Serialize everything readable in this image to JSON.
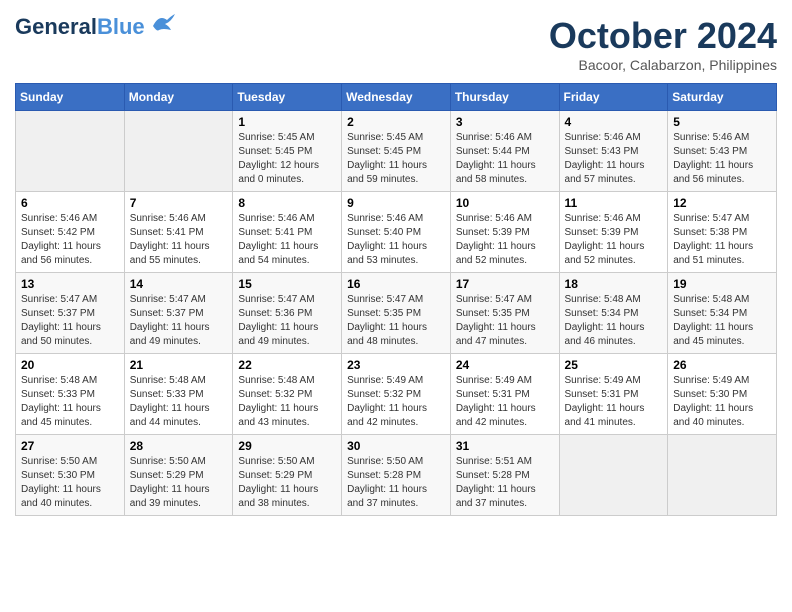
{
  "header": {
    "logo_line1": "General",
    "logo_line2": "Blue",
    "month_year": "October 2024",
    "location": "Bacoor, Calabarzon, Philippines"
  },
  "weekdays": [
    "Sunday",
    "Monday",
    "Tuesday",
    "Wednesday",
    "Thursday",
    "Friday",
    "Saturday"
  ],
  "weeks": [
    [
      {
        "day": "",
        "sunrise": "",
        "sunset": "",
        "daylight": ""
      },
      {
        "day": "",
        "sunrise": "",
        "sunset": "",
        "daylight": ""
      },
      {
        "day": "1",
        "sunrise": "Sunrise: 5:45 AM",
        "sunset": "Sunset: 5:45 PM",
        "daylight": "Daylight: 12 hours and 0 minutes."
      },
      {
        "day": "2",
        "sunrise": "Sunrise: 5:45 AM",
        "sunset": "Sunset: 5:45 PM",
        "daylight": "Daylight: 11 hours and 59 minutes."
      },
      {
        "day": "3",
        "sunrise": "Sunrise: 5:46 AM",
        "sunset": "Sunset: 5:44 PM",
        "daylight": "Daylight: 11 hours and 58 minutes."
      },
      {
        "day": "4",
        "sunrise": "Sunrise: 5:46 AM",
        "sunset": "Sunset: 5:43 PM",
        "daylight": "Daylight: 11 hours and 57 minutes."
      },
      {
        "day": "5",
        "sunrise": "Sunrise: 5:46 AM",
        "sunset": "Sunset: 5:43 PM",
        "daylight": "Daylight: 11 hours and 56 minutes."
      }
    ],
    [
      {
        "day": "6",
        "sunrise": "Sunrise: 5:46 AM",
        "sunset": "Sunset: 5:42 PM",
        "daylight": "Daylight: 11 hours and 56 minutes."
      },
      {
        "day": "7",
        "sunrise": "Sunrise: 5:46 AM",
        "sunset": "Sunset: 5:41 PM",
        "daylight": "Daylight: 11 hours and 55 minutes."
      },
      {
        "day": "8",
        "sunrise": "Sunrise: 5:46 AM",
        "sunset": "Sunset: 5:41 PM",
        "daylight": "Daylight: 11 hours and 54 minutes."
      },
      {
        "day": "9",
        "sunrise": "Sunrise: 5:46 AM",
        "sunset": "Sunset: 5:40 PM",
        "daylight": "Daylight: 11 hours and 53 minutes."
      },
      {
        "day": "10",
        "sunrise": "Sunrise: 5:46 AM",
        "sunset": "Sunset: 5:39 PM",
        "daylight": "Daylight: 11 hours and 52 minutes."
      },
      {
        "day": "11",
        "sunrise": "Sunrise: 5:46 AM",
        "sunset": "Sunset: 5:39 PM",
        "daylight": "Daylight: 11 hours and 52 minutes."
      },
      {
        "day": "12",
        "sunrise": "Sunrise: 5:47 AM",
        "sunset": "Sunset: 5:38 PM",
        "daylight": "Daylight: 11 hours and 51 minutes."
      }
    ],
    [
      {
        "day": "13",
        "sunrise": "Sunrise: 5:47 AM",
        "sunset": "Sunset: 5:37 PM",
        "daylight": "Daylight: 11 hours and 50 minutes."
      },
      {
        "day": "14",
        "sunrise": "Sunrise: 5:47 AM",
        "sunset": "Sunset: 5:37 PM",
        "daylight": "Daylight: 11 hours and 49 minutes."
      },
      {
        "day": "15",
        "sunrise": "Sunrise: 5:47 AM",
        "sunset": "Sunset: 5:36 PM",
        "daylight": "Daylight: 11 hours and 49 minutes."
      },
      {
        "day": "16",
        "sunrise": "Sunrise: 5:47 AM",
        "sunset": "Sunset: 5:35 PM",
        "daylight": "Daylight: 11 hours and 48 minutes."
      },
      {
        "day": "17",
        "sunrise": "Sunrise: 5:47 AM",
        "sunset": "Sunset: 5:35 PM",
        "daylight": "Daylight: 11 hours and 47 minutes."
      },
      {
        "day": "18",
        "sunrise": "Sunrise: 5:48 AM",
        "sunset": "Sunset: 5:34 PM",
        "daylight": "Daylight: 11 hours and 46 minutes."
      },
      {
        "day": "19",
        "sunrise": "Sunrise: 5:48 AM",
        "sunset": "Sunset: 5:34 PM",
        "daylight": "Daylight: 11 hours and 45 minutes."
      }
    ],
    [
      {
        "day": "20",
        "sunrise": "Sunrise: 5:48 AM",
        "sunset": "Sunset: 5:33 PM",
        "daylight": "Daylight: 11 hours and 45 minutes."
      },
      {
        "day": "21",
        "sunrise": "Sunrise: 5:48 AM",
        "sunset": "Sunset: 5:33 PM",
        "daylight": "Daylight: 11 hours and 44 minutes."
      },
      {
        "day": "22",
        "sunrise": "Sunrise: 5:48 AM",
        "sunset": "Sunset: 5:32 PM",
        "daylight": "Daylight: 11 hours and 43 minutes."
      },
      {
        "day": "23",
        "sunrise": "Sunrise: 5:49 AM",
        "sunset": "Sunset: 5:32 PM",
        "daylight": "Daylight: 11 hours and 42 minutes."
      },
      {
        "day": "24",
        "sunrise": "Sunrise: 5:49 AM",
        "sunset": "Sunset: 5:31 PM",
        "daylight": "Daylight: 11 hours and 42 minutes."
      },
      {
        "day": "25",
        "sunrise": "Sunrise: 5:49 AM",
        "sunset": "Sunset: 5:31 PM",
        "daylight": "Daylight: 11 hours and 41 minutes."
      },
      {
        "day": "26",
        "sunrise": "Sunrise: 5:49 AM",
        "sunset": "Sunset: 5:30 PM",
        "daylight": "Daylight: 11 hours and 40 minutes."
      }
    ],
    [
      {
        "day": "27",
        "sunrise": "Sunrise: 5:50 AM",
        "sunset": "Sunset: 5:30 PM",
        "daylight": "Daylight: 11 hours and 40 minutes."
      },
      {
        "day": "28",
        "sunrise": "Sunrise: 5:50 AM",
        "sunset": "Sunset: 5:29 PM",
        "daylight": "Daylight: 11 hours and 39 minutes."
      },
      {
        "day": "29",
        "sunrise": "Sunrise: 5:50 AM",
        "sunset": "Sunset: 5:29 PM",
        "daylight": "Daylight: 11 hours and 38 minutes."
      },
      {
        "day": "30",
        "sunrise": "Sunrise: 5:50 AM",
        "sunset": "Sunset: 5:28 PM",
        "daylight": "Daylight: 11 hours and 37 minutes."
      },
      {
        "day": "31",
        "sunrise": "Sunrise: 5:51 AM",
        "sunset": "Sunset: 5:28 PM",
        "daylight": "Daylight: 11 hours and 37 minutes."
      },
      {
        "day": "",
        "sunrise": "",
        "sunset": "",
        "daylight": ""
      },
      {
        "day": "",
        "sunrise": "",
        "sunset": "",
        "daylight": ""
      }
    ]
  ]
}
